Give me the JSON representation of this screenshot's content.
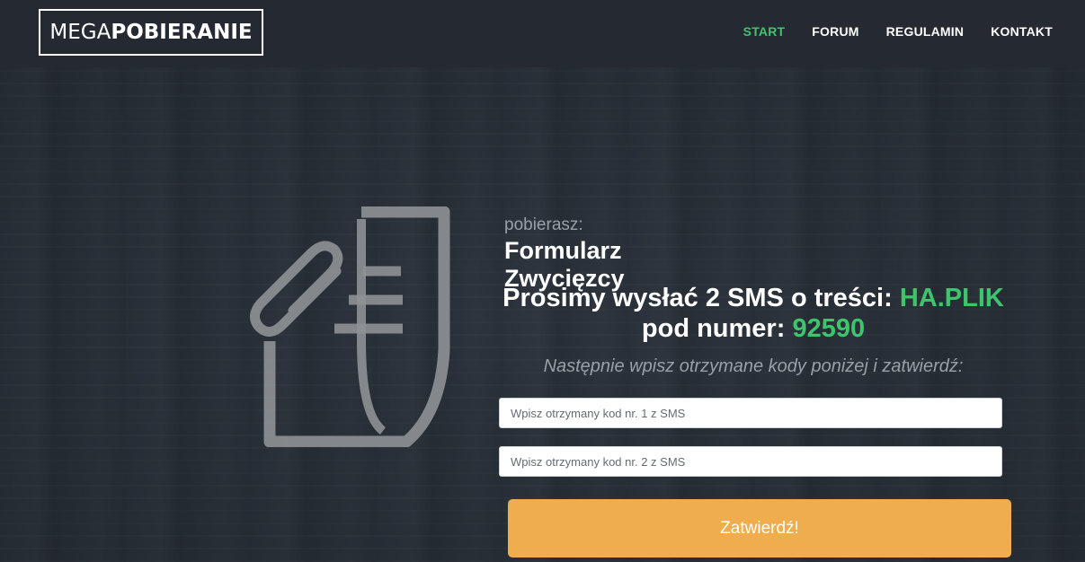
{
  "brand": {
    "logo_thin": "MEGA",
    "logo_bold": "POBIERANIE"
  },
  "nav": {
    "items": [
      {
        "label": "START",
        "active": true
      },
      {
        "label": "FORUM",
        "active": false
      },
      {
        "label": "REGULAMIN",
        "active": false
      },
      {
        "label": "KONTAKT",
        "active": false
      }
    ]
  },
  "download": {
    "prefix": "pobierasz:",
    "file_name": "Formularz Zwycięzcy"
  },
  "sms": {
    "line1_text": "Prosimy wysłać 2 SMS o treści: ",
    "sms_content": "HA.PLIK",
    "line2_text": "pod numer: ",
    "sms_number": "92590"
  },
  "instruction": "Następnie wpisz otrzymane kody poniżej i zatwierdź:",
  "form": {
    "code1_placeholder": "Wpisz otrzymany kod nr. 1 z SMS",
    "code2_placeholder": "Wpisz otrzymany kod nr. 2 z SMS",
    "submit_label": "Zatwierdź!"
  },
  "colors": {
    "accent_green": "#3ec46d",
    "button_orange": "#efad4e",
    "navbar_bg": "#252a32"
  },
  "icons": {
    "document": "paperclip-document-icon"
  }
}
